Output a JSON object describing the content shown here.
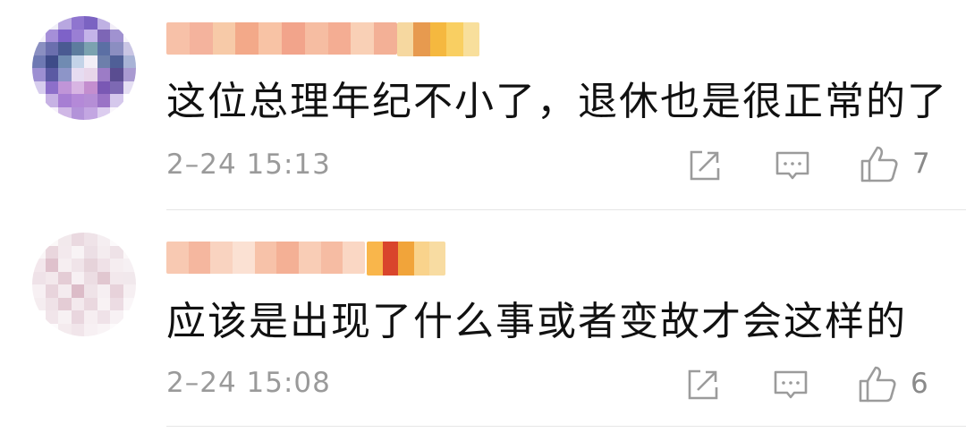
{
  "comments": [
    {
      "text": "这位总理年纪不小了，退休也是很正常的了",
      "time": "2–24 15:13",
      "likes": "7",
      "avatar_colors": [
        "#ffffff",
        "#f0eef8",
        "#b8a7e0",
        "#8f75cf",
        "#7b63c2",
        "#bfb1e3",
        "#f2eef8",
        "#ffffff",
        "#f4f1fa",
        "#a58fd8",
        "#7e62c8",
        "#9a7fd4",
        "#c4b3e9",
        "#7d66b6",
        "#a092d0",
        "#f7f5fb",
        "#8a8fc1",
        "#6b6fae",
        "#4a5a92",
        "#5d7c9e",
        "#7ba2b0",
        "#5b6fa4",
        "#8b8ec1",
        "#c9c5e4",
        "#6e79b3",
        "#3e4b88",
        "#708bb2",
        "#c3d3e8",
        "#f2eef7",
        "#6d7fab",
        "#4f5f97",
        "#a8b3d6",
        "#9d8fd2",
        "#5b5aa3",
        "#8d95c8",
        "#e6dcf1",
        "#e8d6ea",
        "#9c7cc6",
        "#5a4d91",
        "#a99ad1",
        "#d7cdee",
        "#8d6fca",
        "#c095d8",
        "#d8b5e3",
        "#c48ecf",
        "#7a58b4",
        "#7d69b3",
        "#e5dff3",
        "#ffffff",
        "#c7b2e4",
        "#a77ed3",
        "#b489d8",
        "#b58ed6",
        "#9a73c6",
        "#d5c8ec",
        "#ffffff",
        "#ffffff",
        "#f7f2fb",
        "#d0b8e6",
        "#b393d9",
        "#c3a6e2",
        "#dccdef",
        "#faf7fc",
        "#ffffff"
      ],
      "username_colors": [
        "#f7c1a8",
        "#f4b39d",
        "#f7caa8",
        "#f3a989",
        "#f8c3a5",
        "#f2a48b",
        "#f6bda2",
        "#f4ad93",
        "#f9d0b6",
        "#f3b096"
      ],
      "badge_colors": [
        "#f6d8a0",
        "#e79a4f",
        "#f5b83f",
        "#f9cf62",
        "#f8df9c"
      ]
    },
    {
      "text": "应该是出现了什么事或者变故才会这样的",
      "time": "2–24 15:08",
      "likes": "6",
      "avatar_colors": [
        "#ffffff",
        "#fbf8f8",
        "#f2e9ec",
        "#ead9e0",
        "#efe3e8",
        "#f5eef1",
        "#fcfafb",
        "#ffffff",
        "#faf6f7",
        "#e9d6dd",
        "#f3e9ed",
        "#f8f3f5",
        "#ecdfe5",
        "#f4ecef",
        "#eee2e7",
        "#fbf8f9",
        "#f3e7ec",
        "#dfc1cc",
        "#f6eef1",
        "#f0e4e9",
        "#e6d3da",
        "#efe1e7",
        "#f5edf0",
        "#f6f0f3",
        "#efe2e8",
        "#f3e8ec",
        "#e4ccd5",
        "#f7f0f3",
        "#ecdde3",
        "#e1c7d0",
        "#f2e8ec",
        "#f1e8ec",
        "#f7f0f3",
        "#e8d4dc",
        "#f4ebef",
        "#dcbcc8",
        "#efe3e8",
        "#f6eff2",
        "#e7d2da",
        "#f6eff2",
        "#f5edf0",
        "#efe2e7",
        "#e4ccd5",
        "#f3e9ed",
        "#ead8df",
        "#f8f2f4",
        "#ecdce3",
        "#faf6f8",
        "#ffffff",
        "#f1e5ea",
        "#f7f1f3",
        "#e9d6de",
        "#f6eef1",
        "#efe2e8",
        "#f7f1f4",
        "#ffffff",
        "#ffffff",
        "#fdfbfc",
        "#f4ebee",
        "#f1e5ea",
        "#f7f0f3",
        "#f9f4f6",
        "#fdfbfc",
        "#ffffff"
      ],
      "username_colors": [
        "#f8c9b2",
        "#f5b79f",
        "#f9d3c0",
        "#fbe1d3",
        "#f7c2a9",
        "#f4b095",
        "#f9cdb6",
        "#f6bca3",
        "#fad7c4"
      ],
      "badge_colors": [
        "#f9b64b",
        "#d9452c",
        "#f1a43a",
        "#f9d38c",
        "#f8dca2"
      ]
    }
  ],
  "icons": {
    "share": "share-icon",
    "reply": "comment-icon",
    "like": "thumb-up-icon"
  }
}
